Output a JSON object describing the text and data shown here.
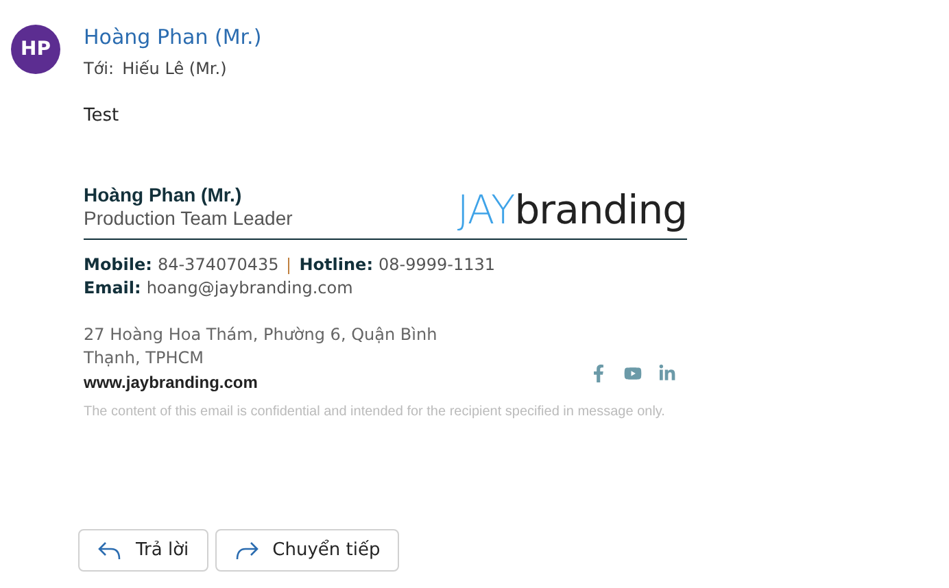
{
  "sender": {
    "initials": "HP",
    "name": "Hoàng Phan (Mr.)",
    "color": "#5c2d91"
  },
  "recipient": {
    "label": "Tới:",
    "name": "Hiếu Lê (Mr.)"
  },
  "body": "Test",
  "signature": {
    "name": "Hoàng Phan (Mr.)",
    "title": "Production Team Leader",
    "logo": {
      "part_1": "JAY",
      "part_2": "branding"
    },
    "contacts": [
      {
        "label": "Mobile:",
        "value": "84-374070435"
      },
      {
        "label": "Hotline:",
        "value": "08-9999-1131"
      }
    ],
    "email": {
      "label": "Email:",
      "value": "hoang@jaybranding.com"
    },
    "address": "27 Hoàng Hoa Thám, Phường 6, Quận Bình Thạnh, TPHCM",
    "website": "www.jaybranding.com",
    "social": [
      {
        "kind": "facebook"
      },
      {
        "kind": "youtube"
      },
      {
        "kind": "linkedin"
      }
    ],
    "disclaimer": "The content of this email is confidential and intended for the recipient specified in message only."
  },
  "actions": [
    {
      "kind": "reply",
      "label": "Trả lời"
    },
    {
      "kind": "forward",
      "label": "Chuyển tiếp"
    }
  ]
}
